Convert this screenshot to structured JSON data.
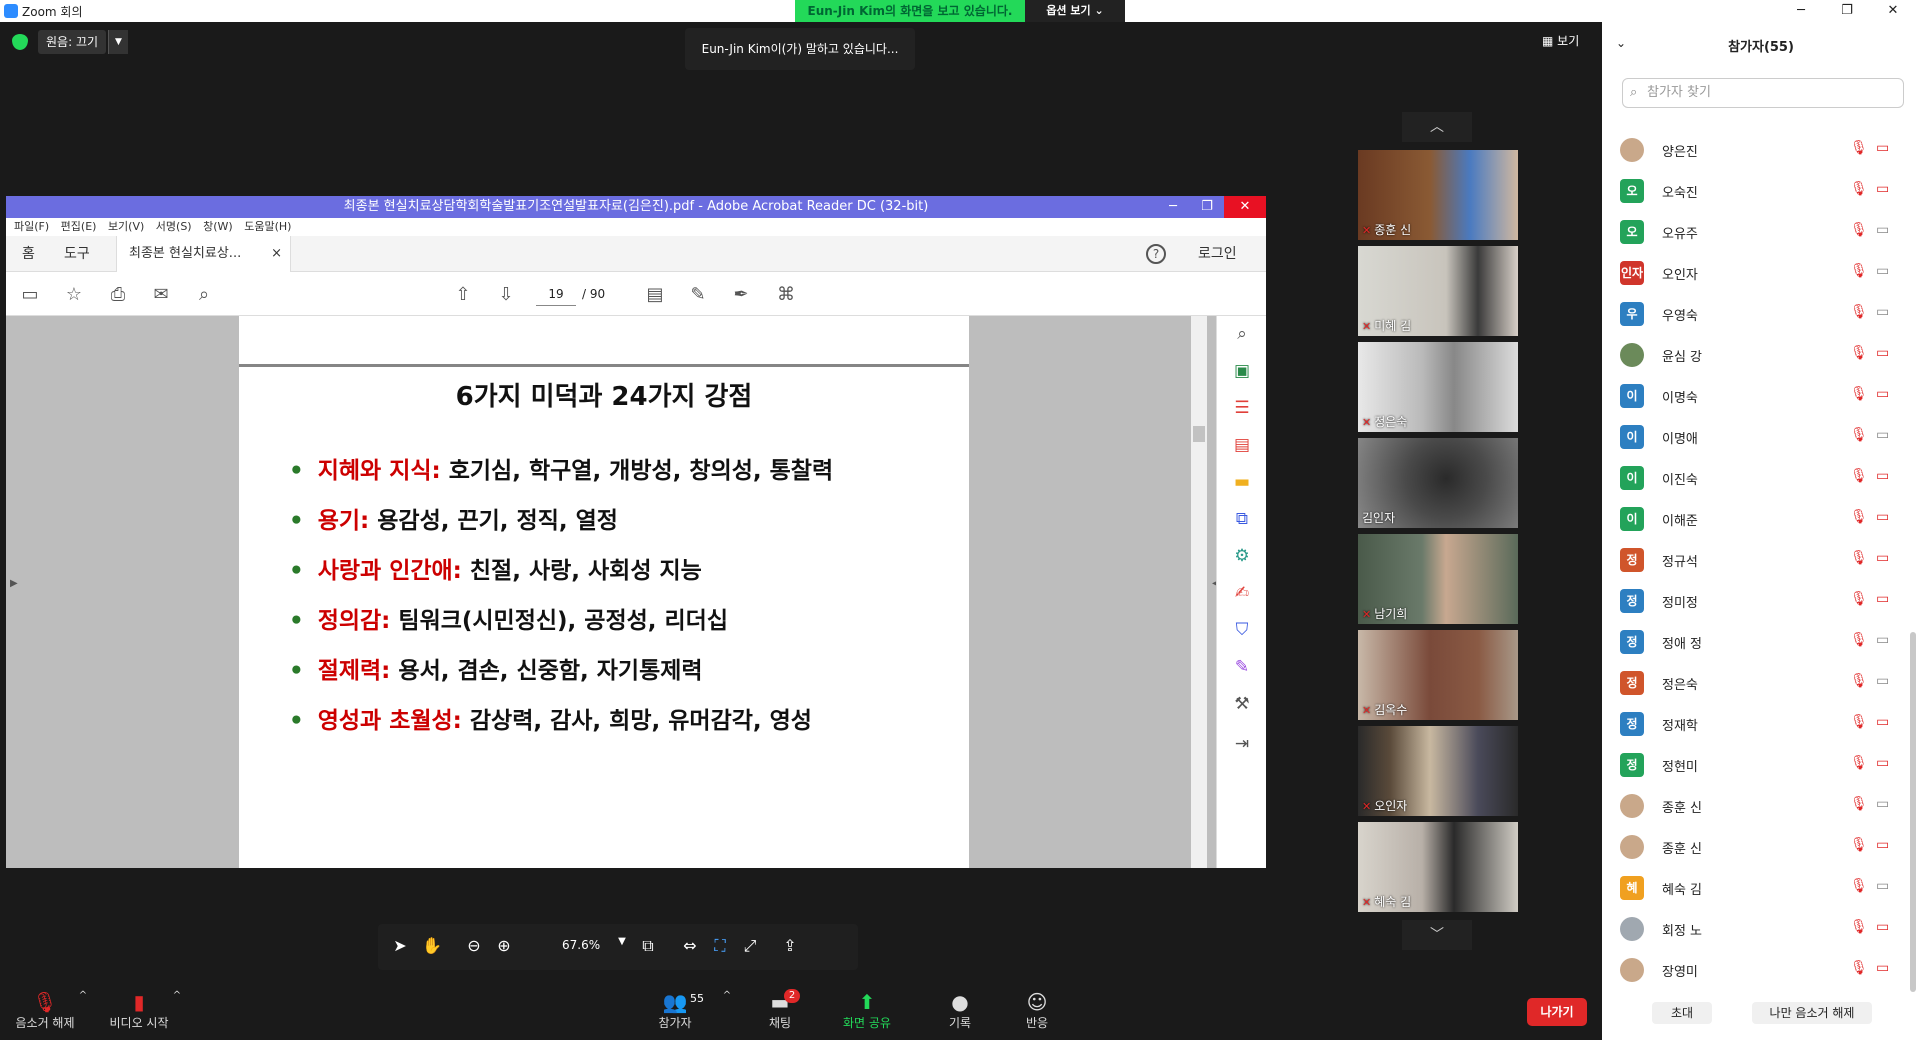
{
  "window": {
    "title": "Zoom 회의",
    "minimize": "─",
    "maximize": "❐",
    "close": "✕"
  },
  "share_banner": {
    "text": "Eun-Jin Kim의 화면을 보고 있습니다.",
    "options": "옵션 보기 ⌄"
  },
  "top_controls": {
    "original_sound": "원음: 끄기",
    "speaking": "Eun-Jin Kim이(가) 말하고 있습니다...",
    "view": "보기"
  },
  "acrobat": {
    "title": "최종본 현실치료상담학회학술발표기조연설발표자료(김은진).pdf - Adobe Acrobat Reader DC (32-bit)",
    "menu": [
      "파일(F)",
      "편집(E)",
      "보기(V)",
      "서명(S)",
      "창(W)",
      "도움말(H)"
    ],
    "tab_home": "홈",
    "tab_tools": "도구",
    "tab_doc": "최종본 현실치료상...",
    "tab_close": "×",
    "login": "로그인",
    "page_current": "19",
    "page_total": "/ 90",
    "zoom": "67.6%"
  },
  "slide": {
    "title": "6가지 미덕과 24가지 강점",
    "bullets": [
      {
        "key": "지혜와 지식:",
        "rest": "호기심, 학구열, 개방성, 창의성, 통찰력"
      },
      {
        "key": "용기:",
        "rest": "용감성, 끈기, 정직, 열정"
      },
      {
        "key": "사랑과 인간애:",
        "rest": "친절, 사랑, 사회성 지능"
      },
      {
        "key": "정의감:",
        "rest": "팀워크(시민정신), 공정성, 리더십"
      },
      {
        "key": "절제력:",
        "rest": "용서, 겸손, 신중함, 자기통제력"
      },
      {
        "key": "영성과 초월성:",
        "rest": "감상력, 감사, 희망, 유머감각, 영성"
      }
    ]
  },
  "video_tiles": [
    "종훈 신",
    "미혜 김",
    "정은숙",
    "김인자",
    "남기희",
    "김옥수",
    "오인자",
    "혜숙 김"
  ],
  "participants_panel": {
    "title": "참가자(55)",
    "search_placeholder": "참가자 찾기",
    "participants": [
      {
        "name": "양은진",
        "avatar": "",
        "color": "#c9a88a",
        "video": "off"
      },
      {
        "name": "오숙진",
        "avatar": "오",
        "color": "#23a35a",
        "video": "off"
      },
      {
        "name": "오유주",
        "avatar": "오",
        "color": "#23a35a",
        "video": "on"
      },
      {
        "name": "오인자",
        "avatar": "인자",
        "color": "#d0352b",
        "video": "on"
      },
      {
        "name": "우영숙",
        "avatar": "우",
        "color": "#2d7fc1",
        "video": "on"
      },
      {
        "name": "윤심 강",
        "avatar": "",
        "color": "#6b8a5a",
        "video": "off"
      },
      {
        "name": "이명숙",
        "avatar": "이",
        "color": "#2d7fc1",
        "video": "off"
      },
      {
        "name": "이명애",
        "avatar": "이",
        "color": "#2d7fc1",
        "video": "on"
      },
      {
        "name": "이진숙",
        "avatar": "이",
        "color": "#23a35a",
        "video": "off"
      },
      {
        "name": "이해준",
        "avatar": "이",
        "color": "#23a35a",
        "video": "off"
      },
      {
        "name": "정규석",
        "avatar": "정",
        "color": "#d0552b",
        "video": "off"
      },
      {
        "name": "정미정",
        "avatar": "정",
        "color": "#2d7fc1",
        "video": "off"
      },
      {
        "name": "정애 정",
        "avatar": "정",
        "color": "#2d7fc1",
        "video": "on"
      },
      {
        "name": "정은숙",
        "avatar": "정",
        "color": "#d0552b",
        "video": "on"
      },
      {
        "name": "정재학",
        "avatar": "정",
        "color": "#2d7fc1",
        "video": "off"
      },
      {
        "name": "정현미",
        "avatar": "정",
        "color": "#23a35a",
        "video": "off"
      },
      {
        "name": "종훈 신",
        "avatar": "",
        "color": "#c9a88a",
        "video": "on"
      },
      {
        "name": "종훈 신",
        "avatar": "",
        "color": "#c9a88a",
        "video": "off"
      },
      {
        "name": "혜숙 김",
        "avatar": "혜",
        "color": "#f0a020",
        "video": "on"
      },
      {
        "name": "회정 노",
        "avatar": "",
        "color": "#a0a8b0",
        "video": "off"
      },
      {
        "name": "장영미",
        "avatar": "",
        "color": "#c9a88a",
        "video": "off"
      }
    ],
    "invite": "초대",
    "unmute_me": "나만 음소거 해제"
  },
  "bottom_toolbar": {
    "unmute": "음소거 해제",
    "start_video": "비디오 시작",
    "participants": "참가자",
    "participant_count": "55",
    "chat": "채팅",
    "chat_badge": "2",
    "share": "화면 공유",
    "record": "기록",
    "reactions": "반응",
    "leave": "나가기"
  }
}
